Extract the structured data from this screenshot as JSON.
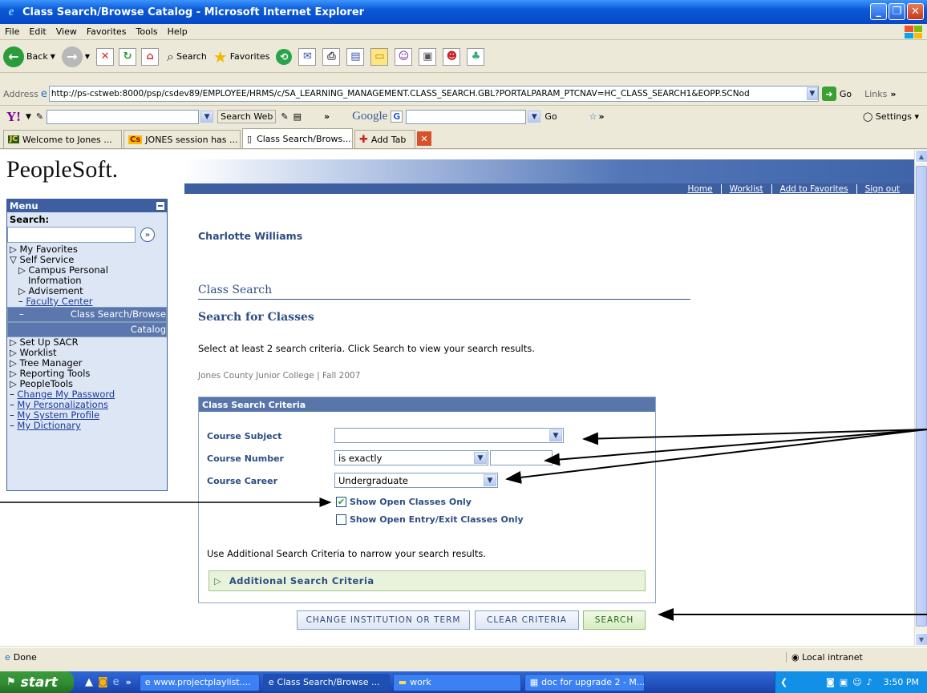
{
  "window": {
    "title": "Class Search/Browse Catalog - Microsoft Internet Explorer"
  },
  "menubar": [
    "File",
    "Edit",
    "View",
    "Favorites",
    "Tools",
    "Help"
  ],
  "toolbar": {
    "back": "Back",
    "search": "Search",
    "favorites": "Favorites"
  },
  "address": {
    "label": "Address",
    "url": "http://ps-cstweb:8000/psp/csdev89/EMPLOYEE/HRMS/c/SA_LEARNING_MANAGEMENT.CLASS_SEARCH.GBL?PORTALPARAM_PTCNAV=HC_CLASS_SEARCH1&EOPP.SCNod",
    "go": "Go",
    "links": "Links"
  },
  "yahoo": {
    "search_web": "Search Web",
    "google": "Google",
    "go": "Go",
    "settings": "Settings"
  },
  "tabs": [
    "Welcome to Jones ...",
    "JONES session has ...",
    "Class Search/Brows...",
    "Add Tab"
  ],
  "ps": {
    "logo": "PeopleSoft.",
    "nav": [
      "Home",
      "Worklist",
      "Add to Favorites",
      "Sign out"
    ]
  },
  "menu": {
    "title": "Menu",
    "search_label": "Search:",
    "items": [
      {
        "label": "My Favorites",
        "type": "top"
      },
      {
        "label": "Self Service",
        "type": "top"
      },
      {
        "label": "Campus Personal",
        "type": "sub"
      },
      {
        "label": "Information",
        "type": "sub2"
      },
      {
        "label": "Advisement",
        "type": "sub"
      },
      {
        "label": "Faculty Center",
        "type": "link"
      },
      {
        "label": "Class Search/Browse",
        "type": "sel"
      },
      {
        "label": "Catalog",
        "type": "sel2"
      },
      {
        "label": "Set Up SACR",
        "type": "top"
      },
      {
        "label": "Worklist",
        "type": "top"
      },
      {
        "label": "Tree Manager",
        "type": "top"
      },
      {
        "label": "Reporting Tools",
        "type": "top"
      },
      {
        "label": "PeopleTools",
        "type": "top"
      },
      {
        "label": "Change My Password",
        "type": "tlink"
      },
      {
        "label": "My Personalizations",
        "type": "tlink"
      },
      {
        "label": "My System Profile",
        "type": "tlink"
      },
      {
        "label": "My Dictionary",
        "type": "tlink"
      }
    ]
  },
  "content": {
    "user": "Charlotte Williams",
    "section": "Class Search",
    "heading": "Search for Classes",
    "instruction": "Select at least 2 search criteria. Click Search to view your search results.",
    "institution": "Jones County Junior College | Fall 2007",
    "criteria": {
      "title": "Class Search Criteria",
      "subject_label": "Course Subject",
      "subject_value": "",
      "number_label": "Course Number",
      "number_op": "is exactly",
      "number_value": "",
      "career_label": "Course Career",
      "career_value": "Undergraduate",
      "open_only": "Show Open Classes Only",
      "open_only_checked": true,
      "open_entry": "Show Open Entry/Exit Classes Only",
      "open_entry_checked": false,
      "hint": "Use Additional Search Criteria to narrow your search results.",
      "additional": "Additional Search Criteria"
    },
    "buttons": {
      "change": "Change Institution or Term",
      "clear": "Clear Criteria",
      "search": "Search"
    }
  },
  "status": {
    "text": "Done",
    "zone": "Local intranet"
  },
  "taskbar": {
    "start": "start",
    "tasks": [
      "www.projectplaylist....",
      "Class Search/Browse ...",
      "work",
      "doc for upgrade 2 - M..."
    ],
    "clock": "3:50 PM"
  }
}
